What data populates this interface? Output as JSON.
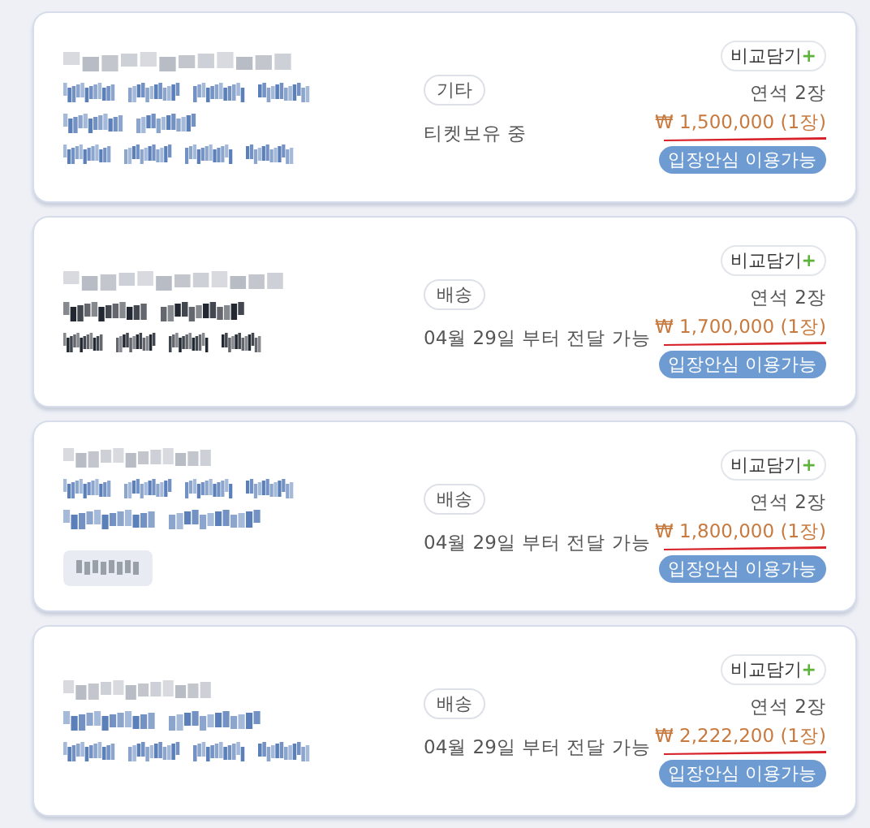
{
  "listings": [
    {
      "masked_lines": [
        {
          "kind": "date"
        },
        {
          "kind": "blue"
        },
        {
          "kind": "blue"
        },
        {
          "kind": "blue"
        }
      ],
      "masked_button": false,
      "delivery_tag": "기타",
      "delivery_note": "티켓보유 중",
      "compare_label": "비교담기",
      "compare_plus": "+",
      "seats": "연석 2장",
      "price": "₩ 1,500,000 (1장)",
      "badge": "입장안심 이용가능"
    },
    {
      "masked_lines": [
        {
          "kind": "date"
        },
        {
          "kind": "black"
        },
        {
          "kind": "black"
        }
      ],
      "masked_button": false,
      "delivery_tag": "배송",
      "delivery_note": "04월 29일 부터 전달 가능",
      "compare_label": "비교담기",
      "compare_plus": "+",
      "seats": "연석 2장",
      "price": "₩ 1,700,000 (1장)",
      "badge": "입장안심 이용가능"
    },
    {
      "masked_lines": [
        {
          "kind": "date"
        },
        {
          "kind": "blue"
        },
        {
          "kind": "blue"
        }
      ],
      "masked_button": true,
      "delivery_tag": "배송",
      "delivery_note": "04월 29일 부터 전달 가능",
      "compare_label": "비교담기",
      "compare_plus": "+",
      "seats": "연석 2장",
      "price": "₩ 1,800,000 (1장)",
      "badge": "입장안심 이용가능"
    },
    {
      "masked_lines": [
        {
          "kind": "date"
        },
        {
          "kind": "blue"
        },
        {
          "kind": "blue"
        }
      ],
      "masked_button": false,
      "delivery_tag": "배송",
      "delivery_note": "04월 29일 부터 전달 가능",
      "compare_label": "비교담기",
      "compare_plus": "+",
      "seats": "연석 2장",
      "price": "₩ 2,222,200 (1장)",
      "badge": "입장안심 이용가능"
    }
  ]
}
